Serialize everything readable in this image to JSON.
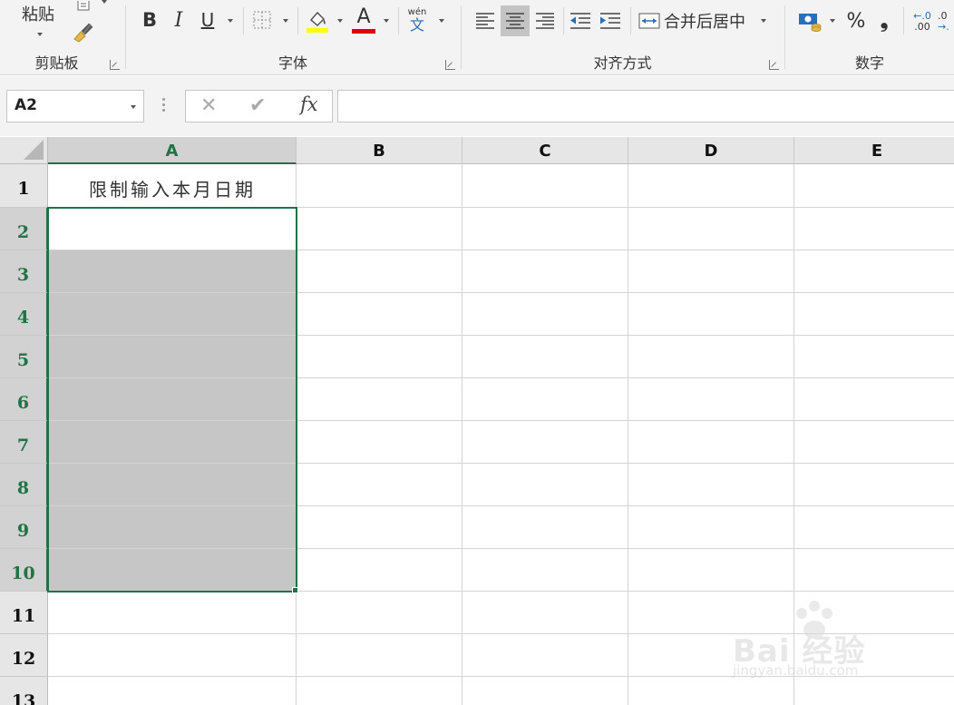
{
  "ribbon": {
    "clipboard": {
      "paste_label": "粘贴",
      "group_title": "剪贴板"
    },
    "font": {
      "group_title": "字体",
      "bold": "B",
      "italic": "I",
      "underline": "U",
      "font_color_letter": "A",
      "phonetic_top": "wén",
      "phonetic_bottom": "文",
      "fill_color": "#ffff00",
      "font_color": "#e00000"
    },
    "alignment": {
      "group_title": "对齐方式",
      "merge_label": "合并后居中"
    },
    "number": {
      "group_title": "数字",
      "percent": "%",
      "comma": "❟",
      "inc_decimal_top": "←.0",
      "inc_decimal_bottom": ".00",
      "dec_decimal_top": ".0",
      "dec_decimal_bottom": "→."
    }
  },
  "formula_bar": {
    "name_box": "A2",
    "cancel": "✕",
    "enter": "✔",
    "fx": "fx",
    "content": ""
  },
  "sheet": {
    "columns": [
      "A",
      "B",
      "C",
      "D",
      "E"
    ],
    "active_column": "A",
    "rows": [
      "1",
      "2",
      "3",
      "4",
      "5",
      "6",
      "7",
      "8",
      "9",
      "10",
      "11",
      "12",
      "13"
    ],
    "cells": {
      "A1": "限制输入本月日期"
    },
    "selection": "A2:A10",
    "active_cell": "A2",
    "accent_color": "#217346"
  },
  "watermark": {
    "brand": "Bai 经验",
    "url": "jingyan.baidu.com"
  }
}
